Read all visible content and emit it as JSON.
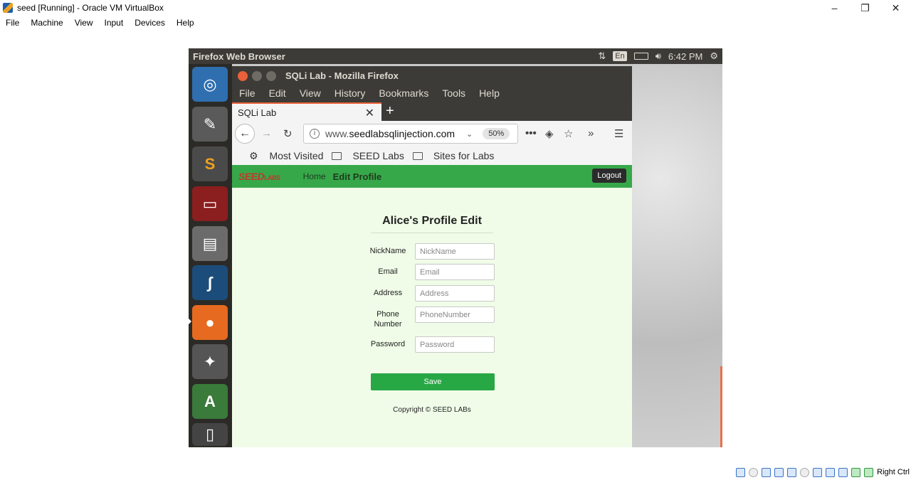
{
  "host": {
    "title": "seed [Running] - Oracle VM VirtualBox",
    "menu": [
      "File",
      "Machine",
      "View",
      "Input",
      "Devices",
      "Help"
    ],
    "window_buttons": [
      "–",
      "❐",
      "✕"
    ],
    "status_right": "Right Ctrl"
  },
  "guest_panel": {
    "title": "Firefox Web Browser",
    "lang": "En",
    "time": "6:42 PM"
  },
  "firefox": {
    "window_title": "SQLi Lab - Mozilla Firefox",
    "menu": [
      "File",
      "Edit",
      "View",
      "History",
      "Bookmarks",
      "Tools",
      "Help"
    ],
    "tab_label": "SQLi Lab",
    "url_prefix": "www.",
    "url_domain": "seedlabsqlinjection.com",
    "zoom": "50%",
    "bookmarks": [
      "Most Visited",
      "SEED Labs",
      "Sites for Labs"
    ]
  },
  "site": {
    "logo_main": "SEED",
    "logo_sub": "LABS",
    "nav_home": "Home",
    "nav_edit": "Edit Profile",
    "logout": "Logout",
    "form_title": "Alice's Profile Edit",
    "fields": [
      {
        "label": "NickName",
        "placeholder": "NickName"
      },
      {
        "label": "Email",
        "placeholder": "Email"
      },
      {
        "label": "Address",
        "placeholder": "Address"
      },
      {
        "label": "Phone Number",
        "placeholder": "PhoneNumber"
      },
      {
        "label": "Password",
        "placeholder": "Password"
      }
    ],
    "save": "Save",
    "copyright": "Copyright © SEED LABs"
  },
  "launcher_icons": [
    "ubuntu-dash-icon",
    "text-editor-icon",
    "sublime-text-icon",
    "terminal-icon",
    "file-manager-icon",
    "wireshark-icon",
    "firefox-icon",
    "settings-icon",
    "software-updater-icon",
    "trash-icon"
  ]
}
